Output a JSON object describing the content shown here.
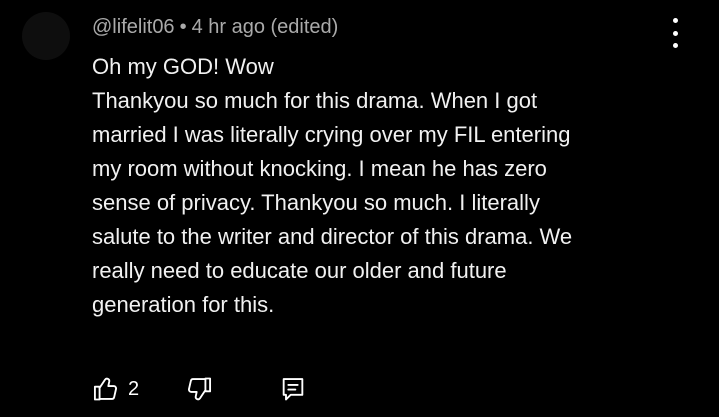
{
  "comment": {
    "username": "@lifelit06",
    "separator": "•",
    "timestamp": "4 hr ago (edited)",
    "lines": [
      "Oh my GOD! Wow",
      "Thankyou so much for this drama. When I got",
      "married I was literally crying over my FIL entering",
      "my room without knocking. I mean he has zero",
      "sense of privacy. Thankyou so much. I literally",
      "salute to the writer and director of this drama. We",
      "really need to educate our older and future",
      "generation for this."
    ],
    "like_count": "2"
  },
  "icons": {
    "menu": "more-vertical-icon",
    "like": "thumbs-up-icon",
    "dislike": "thumbs-down-icon",
    "reply": "reply-comment-icon"
  },
  "colors": {
    "background": "#000000",
    "text": "#f1f1f1",
    "meta_text": "#aaaaaa"
  }
}
